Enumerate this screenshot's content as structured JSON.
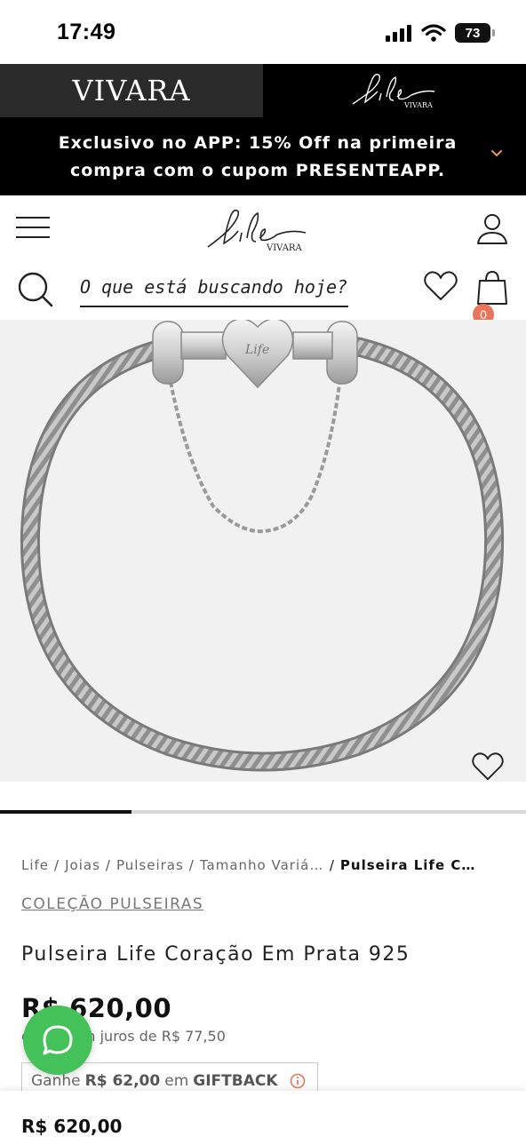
{
  "status_bar": {
    "time": "17:49",
    "battery": "73"
  },
  "brand_bar": {
    "vivara_logo": "VIVARA",
    "life_logo": "Life",
    "life_sub": "VIVARA"
  },
  "promo": {
    "line1": "Exclusivo no APP: 15% Off na primeira",
    "line2": "compra com o cupom PRESENTEAPP."
  },
  "header": {
    "logo_text": "Life",
    "logo_sub": "VIVARA",
    "search_placeholder": "O que está buscando hoje?",
    "cart_count": "0"
  },
  "product_image": {
    "alt": "Pulseira Life Coração Em Prata 925"
  },
  "carousel": {
    "progress": 0.25
  },
  "breadcrumb": {
    "items": [
      "Life",
      "Joias",
      "Pulseiras",
      "Tamanho Variáv…"
    ],
    "current": "Pulseira Life Cora…"
  },
  "product": {
    "collection": "COLEÇÃO PULSEIRAS",
    "title": "Pulseira Life Coração Em Prata 925",
    "price": "R$ 620,00",
    "installments": "ou 8x sem juros de R$ 77,50",
    "giftback_prefix": "Ganhe",
    "giftback_amount": "R$ 62,00",
    "giftback_mid": "em",
    "giftback_label": "GIFTBACK"
  },
  "sticky_bar": {
    "price": "R$ 620,00"
  },
  "colors": {
    "badge": "#e8765c",
    "whatsapp": "#45c15a",
    "promo_bg": "#000000"
  },
  "icons": [
    "signal-icon",
    "wifi-icon",
    "battery-icon",
    "chevron-down-icon",
    "menu-icon",
    "user-icon",
    "search-icon",
    "heart-icon",
    "bag-icon",
    "info-icon",
    "whatsapp-icon"
  ]
}
